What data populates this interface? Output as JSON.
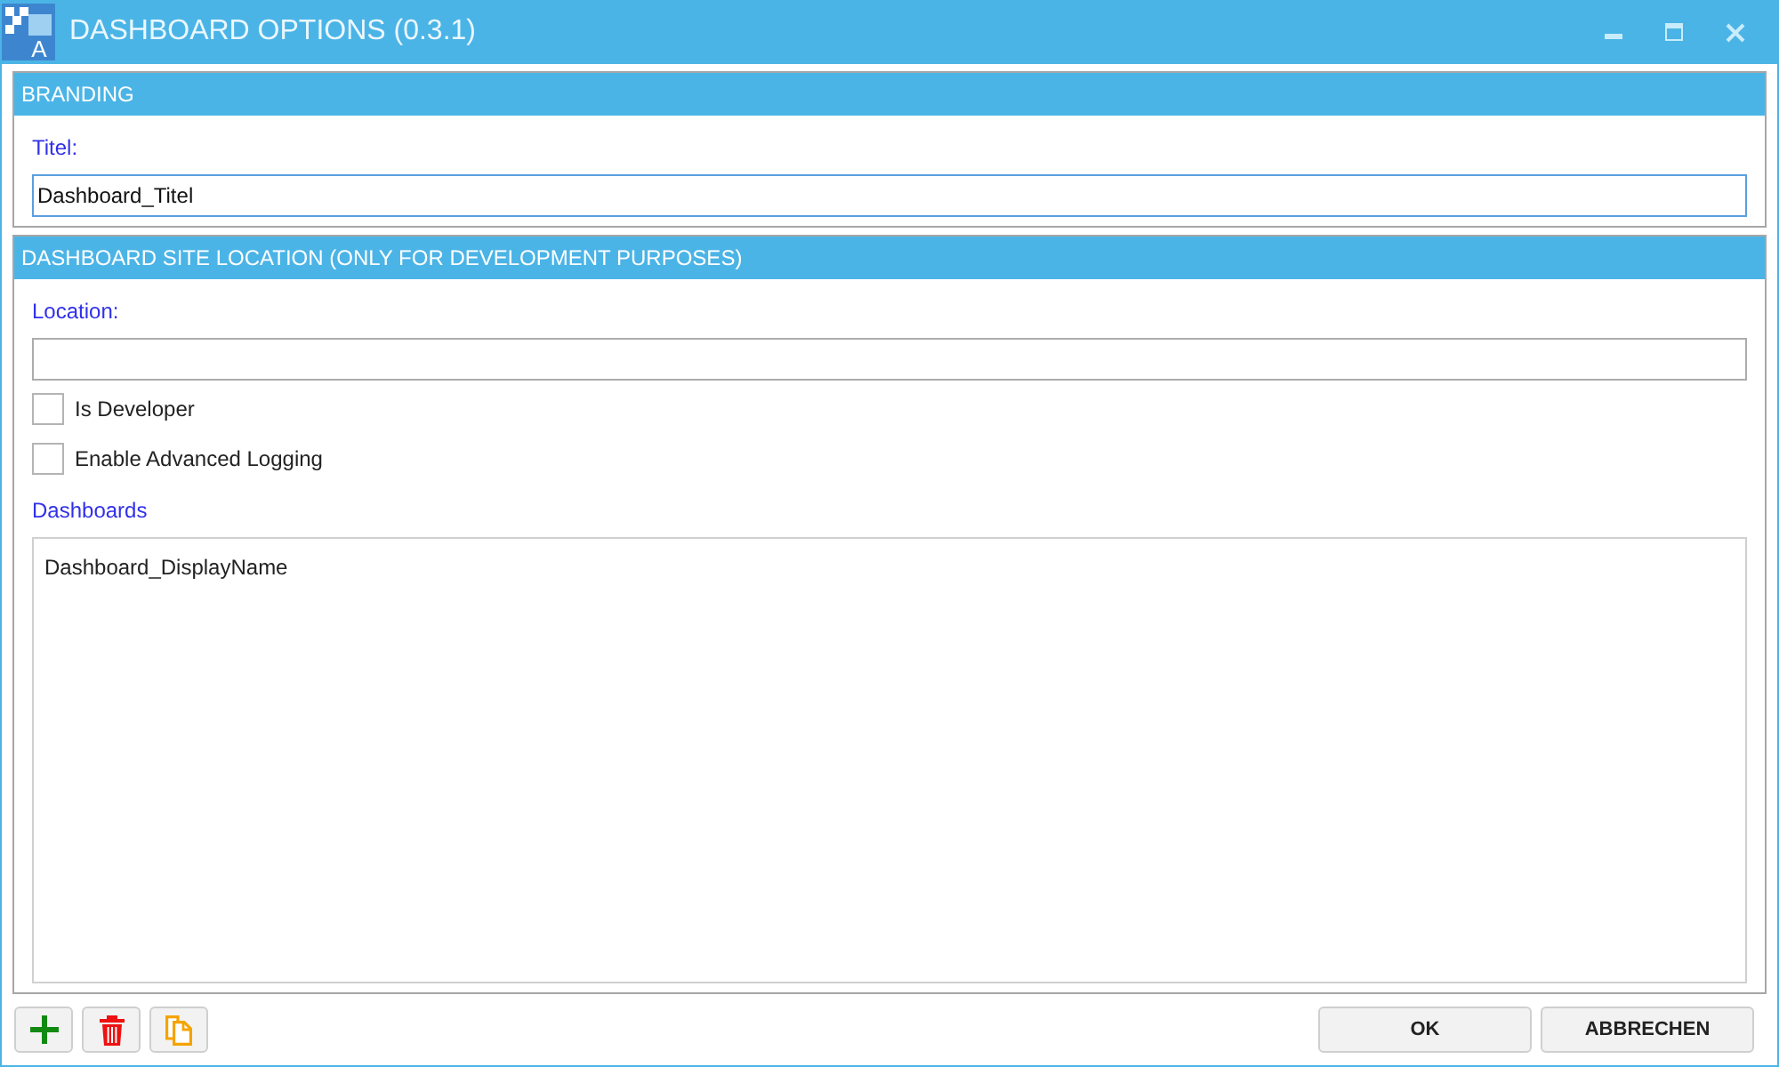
{
  "window": {
    "title": "DASHBOARD OPTIONS (0.3.1)",
    "logo_letter": "A"
  },
  "branding": {
    "header": "BRANDING",
    "title_field": {
      "label": "Titel:",
      "value": "Dashboard_Titel",
      "focused": true
    }
  },
  "site_location": {
    "header": "DASHBOARD SITE LOCATION (ONLY FOR DEVELOPMENT PURPOSES)",
    "location_field": {
      "label": "Location:",
      "focused": false
    },
    "checkboxes": [
      {
        "label": "Is Developer",
        "checked": false
      },
      {
        "label": "Enable Advanced Logging",
        "checked": false
      }
    ],
    "dashboards": {
      "label": "Dashboards",
      "items": [
        {
          "name": "Dashboard_DisplayName",
          "selected": false
        }
      ]
    }
  },
  "tool_buttons": [
    {
      "kind": "add"
    },
    {
      "kind": "delete"
    },
    {
      "kind": "copy"
    }
  ],
  "buttons": [
    {
      "label": "OK"
    },
    {
      "label": "ABBRECHEN"
    }
  ]
}
